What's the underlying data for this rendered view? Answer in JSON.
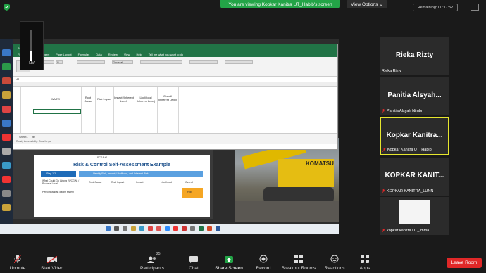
{
  "top": {
    "banner": "You are viewing Kopkar Kanitra UT_Habib's screen",
    "view_options": "View Options",
    "remaining": "Remaining: 00:17:52"
  },
  "excel": {
    "window_title": "Book1 - Excel",
    "menu": [
      "File",
      "Home",
      "Insert",
      "Page Layout",
      "Formulas",
      "Data",
      "Review",
      "View",
      "Help"
    ],
    "search_hint": "Tell me what you want to do",
    "font": "Calibri",
    "font_size": "11",
    "number_format": "General",
    "cell_ref": "A1",
    "columns": [
      "WASW",
      "Root Cause",
      "Risk Impact",
      "Impact (Inherent Level)",
      "Likelihood (Inherent Level)",
      "Overall (Inherent Level)"
    ],
    "sheet": "Sheet1",
    "status": "Ready    Accessibility: Good to go"
  },
  "slide": {
    "small_header": "RCSA #1",
    "title": "Risk & Control Self-Assessment Example",
    "step": "Step 1/2",
    "subtitle": "Identify Risk, Impact, Likelihood, and Inherent Risk",
    "col_head": "What Could Go Wrong (WCGW) / Process Level",
    "row_text": "Penyimpangan dalam sistem",
    "root_cause": "Root Cause",
    "risk_impact": "Risk Impact",
    "impact_val": "Impact",
    "likelihood_val": "Likelihood",
    "overall_val": "Overall",
    "cell_high": "High"
  },
  "meter": {
    "label": "LIV"
  },
  "participants": [
    {
      "display": "Rieka Rizty",
      "label": "Rieka Rizty",
      "muted": false
    },
    {
      "display": "Panitia  Alsyah...",
      "label": "Panitia Alsyah Nimbr",
      "muted": true
    },
    {
      "display": "Kopkar  Kanitra...",
      "label": "Kopkar Kanitra UT_Habib",
      "muted": true,
      "active": true
    },
    {
      "display": "KOPKAR  KANIT...",
      "label": "KOPKAR KANITRA_LUNN",
      "muted": true
    },
    {
      "display": "",
      "label": "kopkar kanitra UT_Imma",
      "muted": true
    }
  ],
  "toolbar": {
    "unmute": "Unmute",
    "start_video": "Start Video",
    "participants": "Participants",
    "participants_count": "25",
    "chat": "Chat",
    "share_screen": "Share Screen",
    "record": "Record",
    "breakout": "Breakout Rooms",
    "reactions": "Reactions",
    "apps": "Apps",
    "leave": "Leave Room"
  },
  "colors": {
    "share_green": "#23a447",
    "excel_green": "#217346",
    "leave_red": "#e02828",
    "active_yellow": "#e6e62e"
  }
}
